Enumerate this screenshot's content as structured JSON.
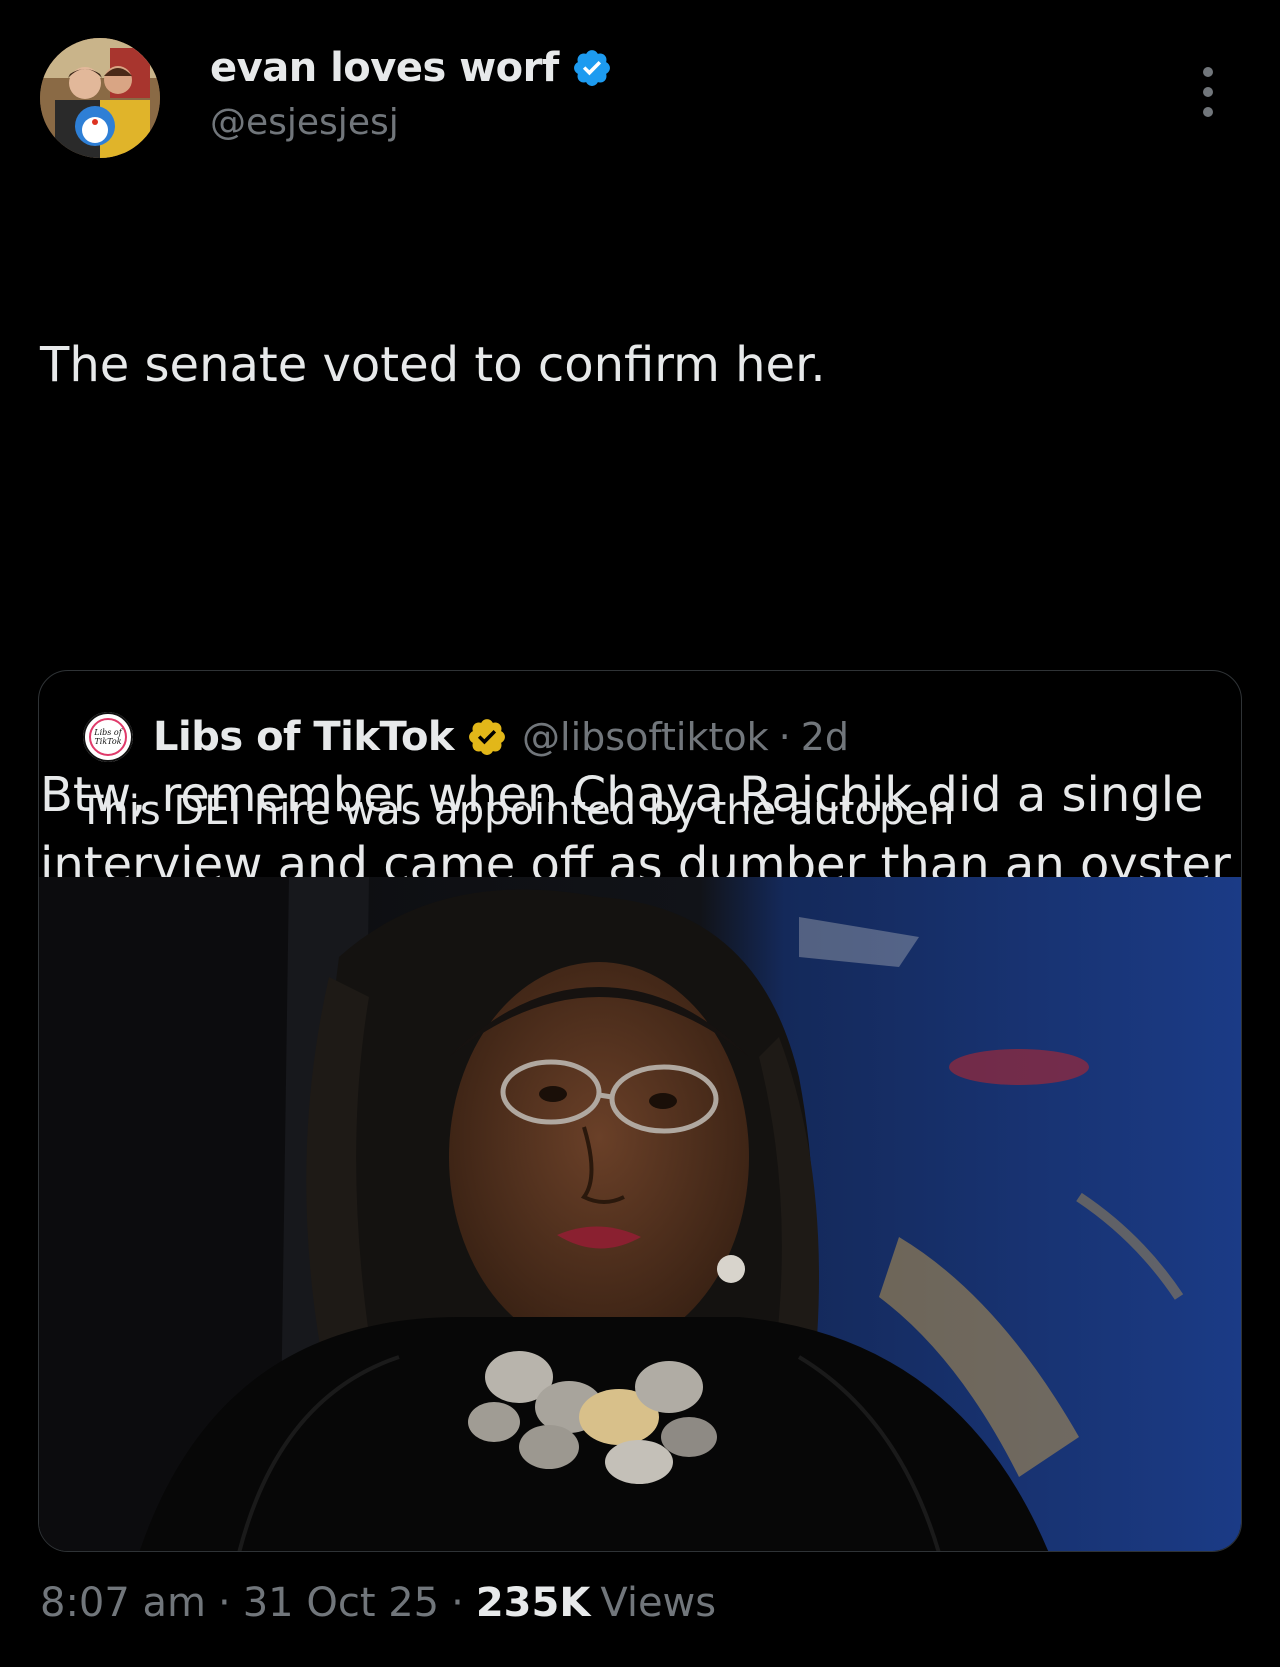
{
  "author": {
    "display_name": "evan loves worf",
    "handle": "@esjesjesj",
    "verified": true,
    "avatar_icon": "profile-photo"
  },
  "tweet": {
    "paragraph_1": "The senate voted to confirm her.",
    "paragraph_2": "Btw, remember when Chaya Raichik did a single interview and came off as dumber than an oyster and then never did an interview again?"
  },
  "quoted": {
    "display_name": "Libs of TikTok",
    "handle": "@libsoftiktok",
    "separator": "·",
    "time": "2d",
    "verified": "gold",
    "avatar_text_1": "Libs of",
    "avatar_text_2": "TikTok",
    "text": "This DEI hire was appointed by the autopen",
    "image_icon": "photo-of-woman-in-judicial-robe"
  },
  "meta": {
    "time": "8:07 am",
    "separator_1": "·",
    "date": "31 Oct 25",
    "separator_2": "·",
    "views_count": "235K",
    "views_label": "Views"
  },
  "colors": {
    "background": "#000000",
    "text": "#e7e9ea",
    "muted": "#71767b",
    "verified_blue": "#1d9bf0",
    "verified_gold": "#e2b719",
    "border": "#2f3336"
  }
}
